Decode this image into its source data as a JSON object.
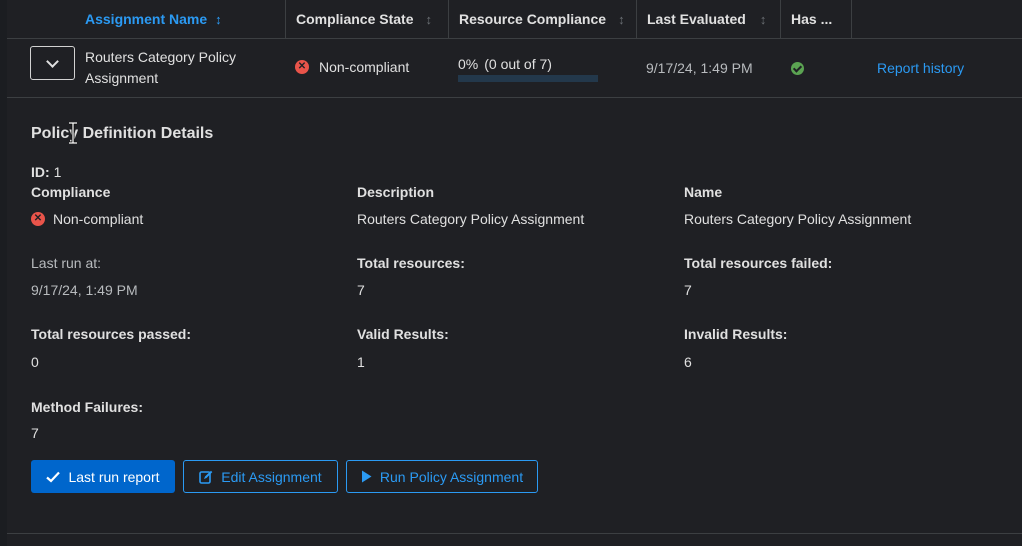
{
  "table": {
    "headers": {
      "assignment_name": "Assignment Name",
      "compliance_state": "Compliance State",
      "resource_compliance": "Resource Compliance",
      "last_evaluated": "Last Evaluated",
      "has": "Has ..."
    },
    "row": {
      "name": "Routers Category Policy Assignment",
      "compliance_state": "Non-compliant",
      "resource_compliance_pct": "0%",
      "resource_compliance_count": "(0 out of 7)",
      "resource_compliance_fraction": 0,
      "last_evaluated": "9/17/24, 1:49 PM",
      "report_history": "Report history"
    }
  },
  "details": {
    "title": "Policy Definition Details",
    "id_label": "ID:",
    "id_value": "1",
    "compliance_label": "Compliance",
    "compliance_value": "Non-compliant",
    "description_label": "Description",
    "description_value": "Routers Category Policy Assignment",
    "name_label": "Name",
    "name_value": "Routers Category Policy Assignment",
    "last_run_label": "Last run at:",
    "last_run_value": "9/17/24, 1:49 PM",
    "total_resources_label": "Total resources:",
    "total_resources_value": "7",
    "total_failed_label": "Total resources failed:",
    "total_failed_value": "7",
    "total_passed_label": "Total resources passed:",
    "total_passed_value": "0",
    "valid_label": "Valid Results:",
    "valid_value": "1",
    "invalid_label": "Invalid Results:",
    "invalid_value": "6",
    "method_failures_label": "Method Failures:",
    "method_failures_value": "7"
  },
  "buttons": {
    "last_run_report": "Last run report",
    "edit_assignment": "Edit Assignment",
    "run_policy_assignment": "Run Policy Assignment"
  },
  "colors": {
    "accent": "#2b9af3",
    "primary_button": "#0066cc",
    "danger": "#e9544a",
    "success": "#5ba352",
    "background": "#1f2024"
  },
  "icons": {
    "sort_active": "sort-icon",
    "status_error": "error-circle-icon",
    "status_success": "check-circle-icon",
    "toggle": "chevron-down-icon",
    "edit": "edit-icon",
    "run": "play-icon"
  }
}
